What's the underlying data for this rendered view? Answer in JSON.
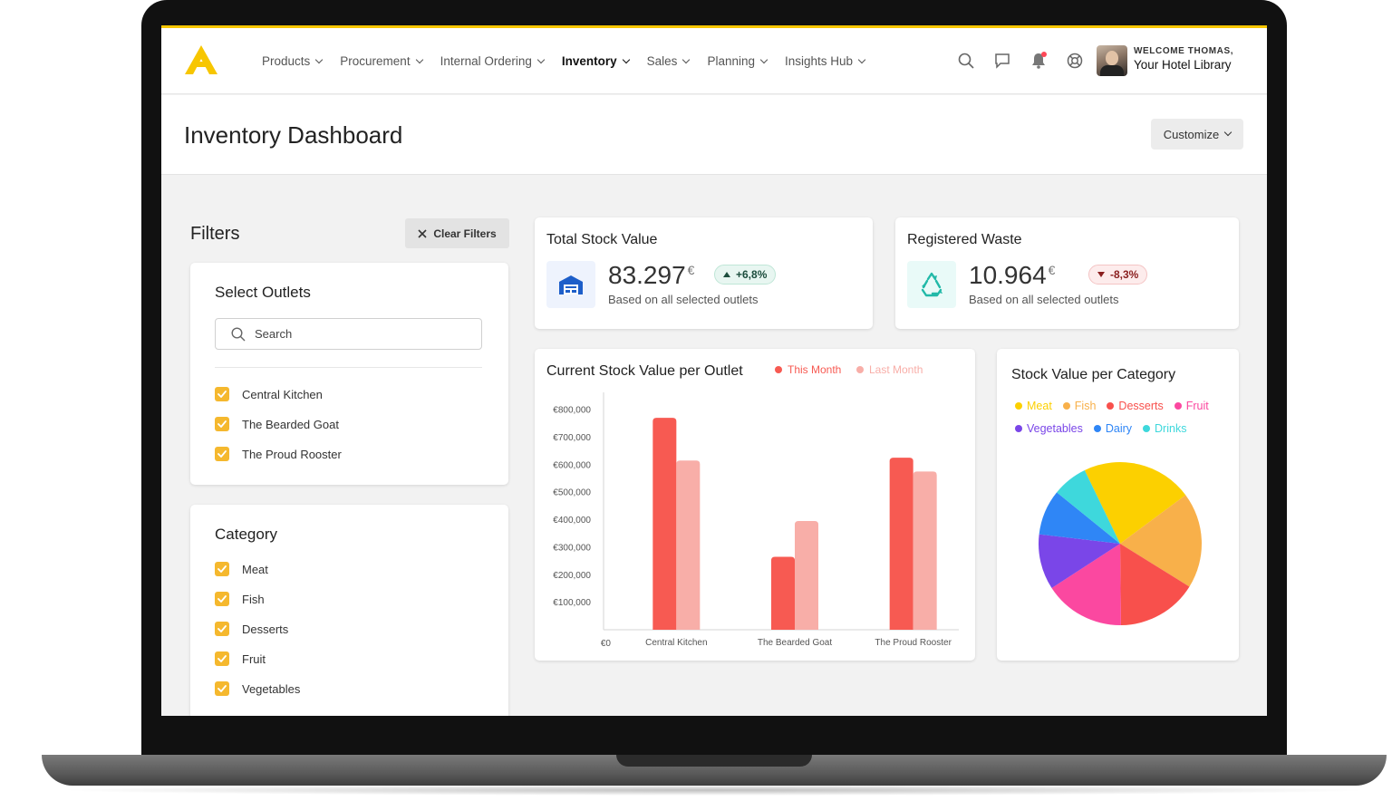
{
  "nav": {
    "items": [
      {
        "label": "Products",
        "active": false
      },
      {
        "label": "Procurement",
        "active": false
      },
      {
        "label": "Internal Ordering",
        "active": false
      },
      {
        "label": "Inventory",
        "active": true
      },
      {
        "label": "Sales",
        "active": false
      },
      {
        "label": "Planning",
        "active": false
      },
      {
        "label": "Insights Hub",
        "active": false
      }
    ],
    "icons": [
      "search-icon",
      "chat-icon",
      "bell-icon",
      "help-icon"
    ],
    "welcome_small": "WELCOME THOMAS,",
    "welcome_big": "Your Hotel Library"
  },
  "header": {
    "title": "Inventory Dashboard",
    "customize_label": "Customize"
  },
  "filters": {
    "title": "Filters",
    "clear_label": "Clear Filters",
    "outlets": {
      "title": "Select Outlets",
      "search_placeholder": "Search",
      "items": [
        "Central Kitchen",
        "The Bearded Goat",
        "The Proud Rooster"
      ]
    },
    "category": {
      "title": "Category",
      "items": [
        "Meat",
        "Fish",
        "Desserts",
        "Fruit",
        "Vegetables"
      ]
    }
  },
  "kpis": {
    "stock": {
      "title": "Total Stock Value",
      "value": "83.297",
      "currency": "€",
      "change": "+6,8%",
      "direction": "up",
      "subtitle": "Based on all selected outlets",
      "icon": "warehouse-icon"
    },
    "waste": {
      "title": "Registered Waste",
      "value": "10.964",
      "currency": "€",
      "change": "-8,3%",
      "direction": "down",
      "subtitle": "Based on all selected outlets",
      "icon": "recycle-icon"
    }
  },
  "colors": {
    "accent": "#f7c600",
    "this_month": "#f75a52",
    "last_month": "#f8aea8",
    "up": "#1c4d3d",
    "down": "#8a1f1f"
  },
  "chart_data": [
    {
      "type": "bar",
      "title": "Current Stock Value per Outlet",
      "categories": [
        "Central Kitchen",
        "The Bearded Goat",
        "The Proud Rooster"
      ],
      "series": [
        {
          "name": "This Month",
          "values": [
            770000,
            265000,
            625000
          ],
          "color": "#f75a52"
        },
        {
          "name": "Last Month",
          "values": [
            615000,
            395000,
            575000
          ],
          "color": "#f8aea8"
        }
      ],
      "ylim": [
        0,
        800000
      ],
      "yticks": [
        0,
        100000,
        200000,
        300000,
        400000,
        500000,
        600000,
        700000,
        800000
      ],
      "ytick_labels": [
        "€0",
        "€100,000",
        "€200,000",
        "€300,000",
        "€400,000",
        "€500,000",
        "€600,000",
        "€700,000",
        "€800,000"
      ],
      "legend": "top",
      "grid": false
    },
    {
      "type": "pie",
      "title": "Stock Value per Category",
      "categories": [
        "Meat",
        "Fish",
        "Desserts",
        "Fruit",
        "Vegetables",
        "Dairy",
        "Drinks"
      ],
      "values": [
        22,
        19,
        16,
        16,
        11,
        9,
        7
      ],
      "colors": [
        "#fcd000",
        "#f8b04a",
        "#f8504c",
        "#fb48a0",
        "#7a46e8",
        "#2f86f6",
        "#3ed8dc"
      ],
      "legend": "top"
    }
  ]
}
